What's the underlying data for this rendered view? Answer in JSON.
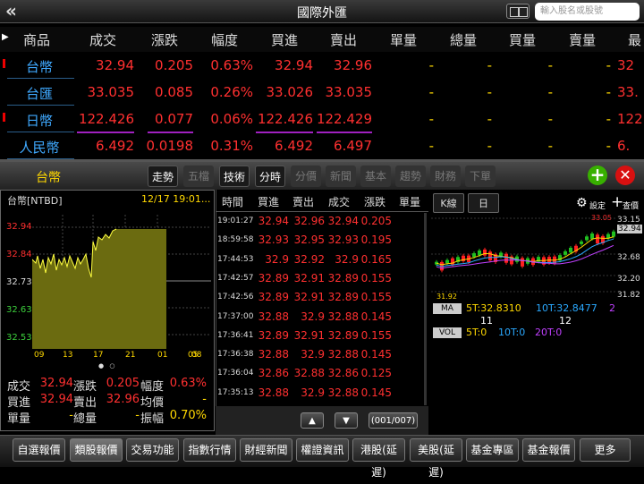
{
  "topbar": {
    "back_icon": "«",
    "title": "國際外匯",
    "search_placeholder": "輸入股名或股號"
  },
  "table": {
    "headers": [
      "商品",
      "成交",
      "漲跌",
      "幅度",
      "買進",
      "賣出",
      "單量",
      "總量",
      "買量",
      "賣量",
      "最"
    ],
    "rows": [
      {
        "name": "台幣",
        "price": "32.94",
        "change": "0.205",
        "pct": "0.63%",
        "bid": "32.94",
        "ask": "32.96",
        "vol": "-",
        "total": "-",
        "bidvol": "-",
        "askvol": "-",
        "last": "32"
      },
      {
        "name": "台匯",
        "price": "33.035",
        "change": "0.085",
        "pct": "0.26%",
        "bid": "33.026",
        "ask": "33.035",
        "vol": "-",
        "total": "-",
        "bidvol": "-",
        "askvol": "-",
        "last": "33."
      },
      {
        "name": "日幣",
        "price": "122.426",
        "change": "0.077",
        "pct": "0.06%",
        "bid": "122.426",
        "ask": "122.429",
        "vol": "-",
        "total": "-",
        "bidvol": "-",
        "askvol": "-",
        "last": "122"
      },
      {
        "name": "人民幣",
        "price": "6.492",
        "change": "0.0198",
        "pct": "0.31%",
        "bid": "6.492",
        "ask": "6.497",
        "vol": "-",
        "total": "-",
        "bidvol": "-",
        "askvol": "-",
        "last": "6."
      }
    ]
  },
  "detail": {
    "stock_name": "台幣",
    "tabs": [
      "走勢",
      "五檔",
      "技術",
      "分時",
      "分價",
      "新聞",
      "基本",
      "趨勢",
      "財務",
      "下單"
    ],
    "active_tabs": [
      0,
      2,
      3
    ],
    "plus_icon": "+",
    "close_icon": "✕"
  },
  "intraday": {
    "name": "台幣[NTBD]",
    "time": "12/17 19:01...",
    "y_ticks": [
      "32.94",
      "32.84",
      "32.73",
      "32.63",
      "32.53"
    ],
    "x_ticks": [
      "09",
      "13",
      "17",
      "21",
      "01",
      "05"
    ],
    "x_tick_overlap": "08",
    "quotes": [
      {
        "l1": "成交",
        "v1": "32.94",
        "l2": "漲跌",
        "v2": "0.205",
        "l3": "幅度",
        "v3": "0.63%"
      },
      {
        "l1": "買進",
        "v1": "32.94",
        "l2": "賣出",
        "v2": "32.96",
        "l3": "均價",
        "v3": "-"
      },
      {
        "l1": "單量",
        "v1": "-",
        "l2": "總量",
        "v2": "-",
        "l3": "振幅",
        "v3": "0.70%"
      }
    ]
  },
  "ticks": {
    "headers": [
      "時間",
      "買進",
      "賣出",
      "成交",
      "漲跌",
      "單量"
    ],
    "rows": [
      {
        "time": "19:01:27",
        "bid": "32.94",
        "ask": "32.96",
        "price": "32.94",
        "chg": "0.205"
      },
      {
        "time": "18:59:58",
        "bid": "32.93",
        "ask": "32.95",
        "price": "32.93",
        "chg": "0.195"
      },
      {
        "time": "17:44:53",
        "bid": "32.9",
        "ask": "32.92",
        "price": "32.9",
        "chg": "0.165"
      },
      {
        "time": "17:42:57",
        "bid": "32.89",
        "ask": "32.91",
        "price": "32.89",
        "chg": "0.155"
      },
      {
        "time": "17:42:56",
        "bid": "32.89",
        "ask": "32.91",
        "price": "32.89",
        "chg": "0.155"
      },
      {
        "time": "17:37:00",
        "bid": "32.88",
        "ask": "32.9",
        "price": "32.88",
        "chg": "0.145"
      },
      {
        "time": "17:36:41",
        "bid": "32.89",
        "ask": "32.91",
        "price": "32.89",
        "chg": "0.155"
      },
      {
        "time": "17:36:38",
        "bid": "32.88",
        "ask": "32.9",
        "price": "32.88",
        "chg": "0.145"
      },
      {
        "time": "17:36:04",
        "bid": "32.86",
        "ask": "32.88",
        "price": "32.86",
        "chg": "0.125"
      },
      {
        "time": "17:35:13",
        "bid": "32.88",
        "ask": "32.9",
        "price": "32.88",
        "chg": "0.145"
      }
    ],
    "up_icon": "▲",
    "down_icon": "▼",
    "page": "(001/007)"
  },
  "kline": {
    "btn_k": "K線",
    "btn_day": "日",
    "settings": "設定",
    "query": "查價",
    "y_ticks": [
      "33.15",
      "32.94",
      "32.68",
      "32.20",
      "31.82"
    ],
    "high_label": "33.05",
    "low_label": "31.92",
    "ma_label": "MA",
    "ma5": "5T:32.8310",
    "ma10": "10T:32.8477",
    "ma20": "2",
    "x_ticks": [
      "11",
      "12"
    ],
    "vol_label": "VOL",
    "vol5": "5T:0",
    "vol10": "10T:0",
    "vol20": "20T:0"
  },
  "bottom": [
    "自選報價",
    "類股報價",
    "交易功能",
    "指數行情",
    "財經新聞",
    "權證資訊",
    "港股(延遲)",
    "美股(延遲)",
    "基金專區",
    "基金報價",
    "更多"
  ],
  "bottom_active": 1
}
